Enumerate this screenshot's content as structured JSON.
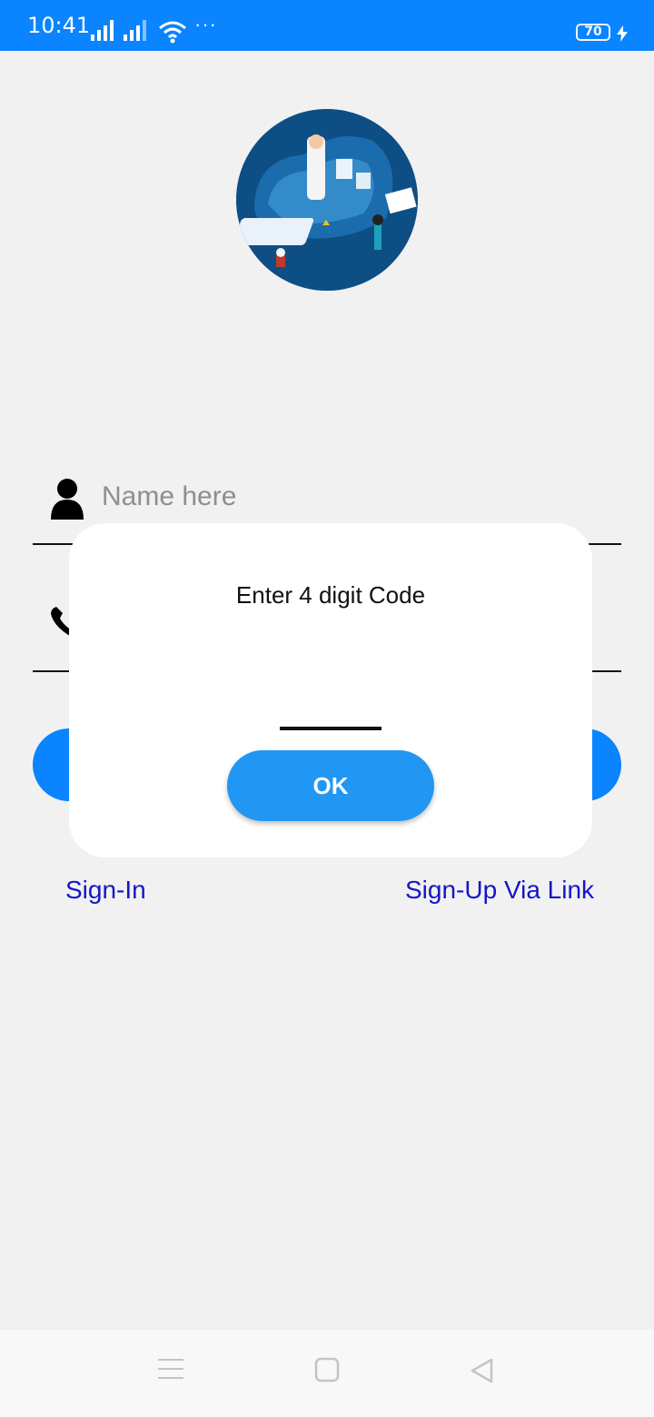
{
  "status_bar": {
    "time": "10:41",
    "more": "···",
    "battery": "70",
    "bar_color": "#0a84ff"
  },
  "hero": {
    "icon": "telemedicine-illustration"
  },
  "form": {
    "name_placeholder": "Name here",
    "name_icon": "user-icon",
    "phone_icon": "phone-icon",
    "button_color": "#0a84ff"
  },
  "links": {
    "sign_in": "Sign-In",
    "sign_up_link": "Sign-Up Via Link",
    "color": "#1515c8"
  },
  "dialog": {
    "title": "Enter 4 digit Code",
    "code_value": "",
    "ok_label": "OK",
    "ok_color": "#2196f3"
  },
  "nav_bar": {
    "items": [
      "menu-icon",
      "home-square-icon",
      "back-triangle-icon"
    ]
  }
}
